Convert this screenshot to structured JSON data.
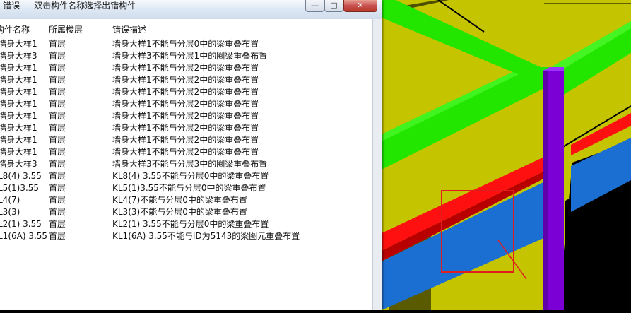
{
  "window": {
    "title": "错误 - - 双击构件名称选择出错构件",
    "min_glyph": "—",
    "max_glyph": "□",
    "close_glyph": "✕"
  },
  "columns": [
    "构件名称",
    "所属楼层",
    "错误描述"
  ],
  "rows": [
    {
      "name": "墙身大样1",
      "floor": "首层",
      "desc": "墙身大样1不能与分层0中的梁重叠布置"
    },
    {
      "name": "墙身大样3",
      "floor": "首层",
      "desc": "墙身大样3不能与分层1中的圈梁重叠布置"
    },
    {
      "name": "墙身大样1",
      "floor": "首层",
      "desc": "墙身大样1不能与分层2中的梁重叠布置"
    },
    {
      "name": "墙身大样1",
      "floor": "首层",
      "desc": "墙身大样1不能与分层2中的梁重叠布置"
    },
    {
      "name": "墙身大样1",
      "floor": "首层",
      "desc": "墙身大样1不能与分层2中的梁重叠布置"
    },
    {
      "name": "墙身大样1",
      "floor": "首层",
      "desc": "墙身大样1不能与分层2中的梁重叠布置"
    },
    {
      "name": "墙身大样1",
      "floor": "首层",
      "desc": "墙身大样1不能与分层2中的梁重叠布置"
    },
    {
      "name": "墙身大样1",
      "floor": "首层",
      "desc": "墙身大样1不能与分层2中的梁重叠布置"
    },
    {
      "name": "墙身大样1",
      "floor": "首层",
      "desc": "墙身大样1不能与分层2中的梁重叠布置"
    },
    {
      "name": "墙身大样1",
      "floor": "首层",
      "desc": "墙身大样1不能与分层2中的梁重叠布置"
    },
    {
      "name": "墙身大样3",
      "floor": "首层",
      "desc": "墙身大样3不能与分层3中的圈梁重叠布置"
    },
    {
      "name": "L8(4) 3.55",
      "floor": "首层",
      "desc": "KL8(4) 3.55不能与分层0中的梁重叠布置"
    },
    {
      "name": "L5(1)3.55",
      "floor": "首层",
      "desc": "KL5(1)3.55不能与分层0中的梁重叠布置"
    },
    {
      "name": "L4(7)",
      "floor": "首层",
      "desc": "KL4(7)不能与分层0中的梁重叠布置"
    },
    {
      "name": "L3(3)",
      "floor": "首层",
      "desc": "KL3(3)不能与分层0中的梁重叠布置"
    },
    {
      "name": "L2(1) 3.55",
      "floor": "首层",
      "desc": "KL2(1) 3.55不能与分层0中的梁重叠布置"
    },
    {
      "name": "L1(6A) 3.55",
      "floor": "首层",
      "desc": "KL1(6A) 3.55不能与ID为5143的梁图元重叠布置"
    }
  ],
  "colors": {
    "floor_yellow": "#c4c400",
    "beam_green": "#22e600",
    "column_purple": "#7a00d6",
    "beam_red": "#ff1010",
    "beam_blue": "#1c6fd2",
    "highlight_box": "#e02020"
  }
}
